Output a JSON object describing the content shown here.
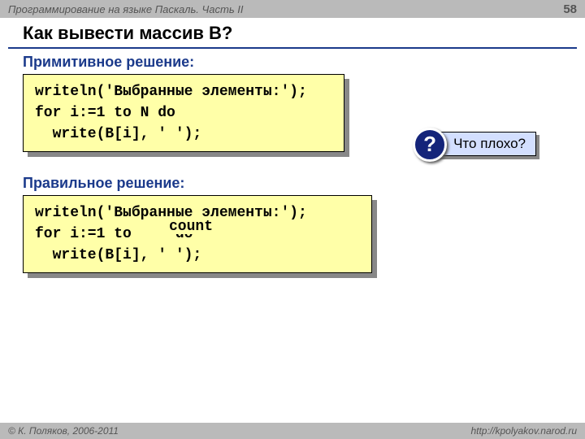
{
  "header": {
    "course": "Программирование на языке Паскаль. Часть II",
    "page": "58"
  },
  "title": "Как вывести массив B?",
  "section1": {
    "label": "Примитивное решение:",
    "line1": "writeln('Выбранные элементы:');",
    "line2": "for i:=1 to N do",
    "line3": "  write(B[i], ' ');"
  },
  "callout": {
    "mark": "?",
    "text": "Что плохо?"
  },
  "section2": {
    "label": "Правильное решение:",
    "line1": "writeln('Выбранные элементы:');",
    "line2": "for i:=1 to     do",
    "line3": "  write(B[i], ' ');",
    "patch": "count"
  },
  "footer": {
    "copyright": "© К. Поляков, 2006-2011",
    "url": "http://kpolyakov.narod.ru"
  }
}
